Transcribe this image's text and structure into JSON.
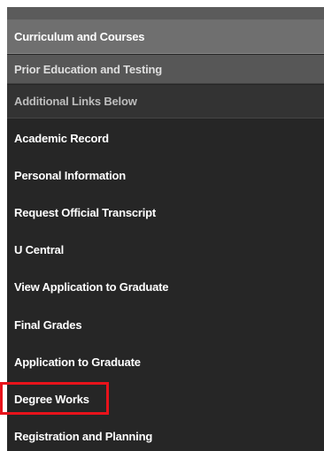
{
  "menu": {
    "sections": {
      "curriculum": "Curriculum and Courses",
      "prior": "Prior Education and Testing",
      "additional": "Additional Links Below"
    },
    "links": [
      "Academic Record",
      "Personal Information",
      "Request Official Transcript",
      "U Central",
      "View Application to Graduate",
      "Final Grades",
      "Application to Graduate",
      "Degree Works",
      "Registration and Planning"
    ],
    "highlighted_link": "Degree Works"
  },
  "colors": {
    "menu_background": "#262626",
    "section_active": "#6f6f6f",
    "section_secondary": "#575757",
    "highlight_border": "#e8131b"
  }
}
